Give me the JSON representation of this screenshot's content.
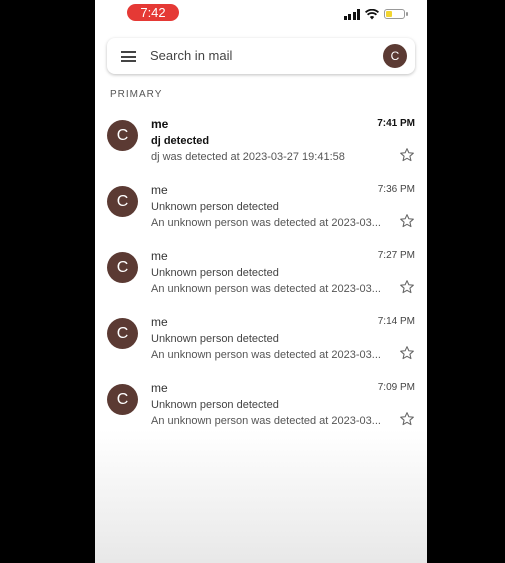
{
  "status_bar": {
    "time": "7:42",
    "accent_color": "#e53935",
    "icons": [
      "cellular-signal-icon",
      "wifi-icon",
      "battery-icon"
    ],
    "battery_level": 0.35
  },
  "search": {
    "placeholder": "Search in mail",
    "account_initial": "C"
  },
  "section": {
    "label": "PRIMARY"
  },
  "emails": [
    {
      "initial": "C",
      "sender": "me",
      "time": "7:41 PM",
      "subject": "dj detected",
      "snippet": "dj was detected at 2023-03-27 19:41:58",
      "unread": true
    },
    {
      "initial": "C",
      "sender": "me",
      "time": "7:36 PM",
      "subject": "Unknown person detected",
      "snippet": "An unknown person was detected at 2023-03...",
      "unread": false
    },
    {
      "initial": "C",
      "sender": "me",
      "time": "7:27 PM",
      "subject": "Unknown person detected",
      "snippet": "An unknown person was detected at 2023-03...",
      "unread": false
    },
    {
      "initial": "C",
      "sender": "me",
      "time": "7:14 PM",
      "subject": "Unknown person detected",
      "snippet": "An unknown person was detected at 2023-03...",
      "unread": false
    },
    {
      "initial": "C",
      "sender": "me",
      "time": "7:09 PM",
      "subject": "Unknown person detected",
      "snippet": "An unknown person was detected at 2023-03...",
      "unread": false
    }
  ],
  "colors": {
    "avatar": "#5b3a33"
  }
}
